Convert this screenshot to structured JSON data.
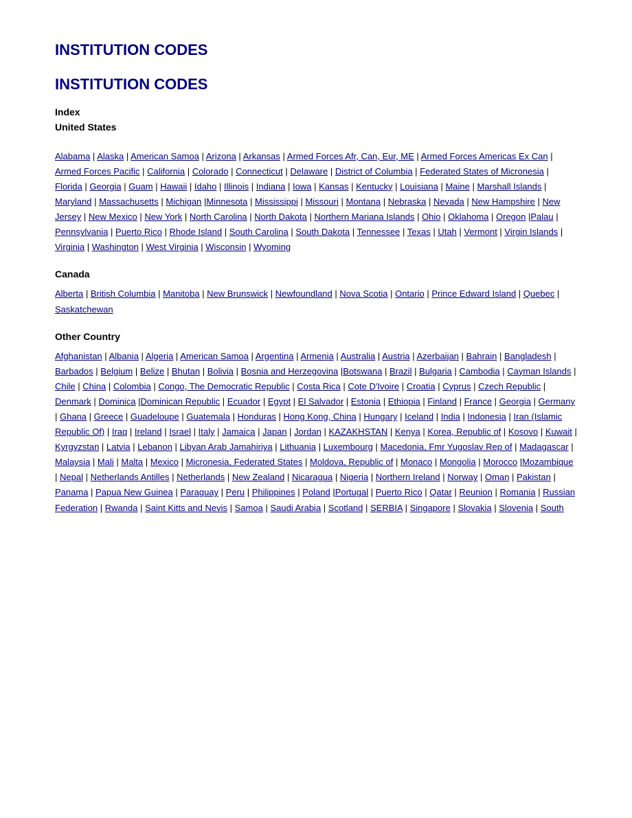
{
  "page": {
    "title1": "INSTITUTION CODES",
    "title2": "INSTITUTION CODES",
    "index_label": "Index",
    "united_states_label": "United States",
    "canada_label": "Canada",
    "other_country_label": "Other Country"
  },
  "us_states": [
    "Alabama",
    "Alaska",
    "American Samoa",
    "Arizona",
    "Arkansas",
    "Armed Forces Afr, Can, Eur, ME",
    "Armed Forces Americas Ex Can",
    "Armed Forces Pacific",
    "California",
    "Colorado",
    "Connecticut",
    "Delaware",
    "District of Columbia",
    "Federated States of Micronesia",
    "Florida",
    "Georgia",
    "Guam",
    "Hawaii",
    "Idaho",
    "Illinois",
    "Indiana",
    "Iowa",
    "Kansas",
    "Kentucky",
    "Louisiana",
    "Maine",
    "Marshall Islands",
    "Maryland",
    "Massachusetts",
    "Michigan",
    "Minnesota",
    "Mississippi",
    "Missouri",
    "Montana",
    "Nebraska",
    "Nevada",
    "New Hampshire",
    "New Jersey",
    "New Mexico",
    "New York",
    "North Carolina",
    "North Dakota",
    "Northern Mariana Islands",
    "Ohio",
    "Oklahoma",
    "Oregon",
    "Palau",
    "Pennsylvania",
    "Puerto Rico",
    "Rhode Island",
    "South Carolina",
    "South Dakota",
    "Tennessee",
    "Texas",
    "Utah",
    "Vermont",
    "Virgin Islands",
    "Virginia",
    "Washington",
    "West Virginia",
    "Wisconsin",
    "Wyoming"
  ],
  "canada_provinces": [
    "Alberta",
    "British Columbia",
    "Manitoba",
    "New Brunswick",
    "Newfoundland",
    "Nova Scotia",
    "Ontario",
    "Prince Edward Island",
    "Quebec",
    "Saskatchewan"
  ],
  "other_countries": [
    "Afghanistan",
    "Albania",
    "Algeria",
    "American Samoa",
    "Argentina",
    "Armenia",
    "Australia",
    "Austria",
    "Azerbaijan",
    "Bahrain",
    "Bangladesh",
    "Barbados",
    "Belgium",
    "Belize",
    "Bhutan",
    "Bolivia",
    "Bosnia and Herzegovina",
    "Botswana",
    "Brazil",
    "Bulgaria",
    "Cambodia",
    "Cayman Islands",
    "Chile",
    "China",
    "Colombia",
    "Congo, The Democratic Republic",
    "Costa Rica",
    "Cote D'Ivoire",
    "Croatia",
    "Cyprus",
    "Czech Republic",
    "Denmark",
    "Dominica",
    "Dominican Republic",
    "Ecuador",
    "Egypt",
    "El Salvador",
    "Estonia",
    "Ethiopia",
    "Finland",
    "France",
    "Georgia",
    "Germany",
    "Ghana",
    "Greece",
    "Guadeloupe",
    "Guatemala",
    "Honduras",
    "Hong Kong, China",
    "Hungary",
    "Iceland",
    "India",
    "Indonesia",
    "Iran (Islamic Republic Of)",
    "Iraq",
    "Ireland",
    "Israel",
    "Italy",
    "Jamaica",
    "Japan",
    "Jordan",
    "KAZAKHSTAN",
    "Kenya",
    "Korea, Republic of",
    "Kosovo",
    "Kuwait",
    "Kyrgyzstan",
    "Latvia",
    "Lebanon",
    "Libyan Arab Jamahiriya",
    "Lithuania",
    "Luxembourg",
    "Macedonia, Fmr Yugoslav Rep of",
    "Madagascar",
    "Malaysia",
    "Mali",
    "Malta",
    "Mexico",
    "Micronesia, Federated States",
    "Moldova, Republic of",
    "Monaco",
    "Mongolia",
    "Morocco",
    "Mozambique",
    "Nepal",
    "Netherlands Antilles",
    "Netherlands",
    "New Zealand",
    "Nicaragua",
    "Nigeria",
    "Northern Ireland",
    "Norway",
    "Oman",
    "Pakistan",
    "Panama",
    "Papua New Guinea",
    "Paraguay",
    "Peru",
    "Philippines",
    "Poland",
    "Portugal",
    "Puerto Rico",
    "Qatar",
    "Reunion",
    "Romania",
    "Russian Federation",
    "Rwanda",
    "Saint Kitts and Nevis",
    "Samoa",
    "Saudi Arabia",
    "Scotland",
    "SERBIA",
    "Singapore",
    "Slovakia",
    "Slovenia",
    "South"
  ]
}
